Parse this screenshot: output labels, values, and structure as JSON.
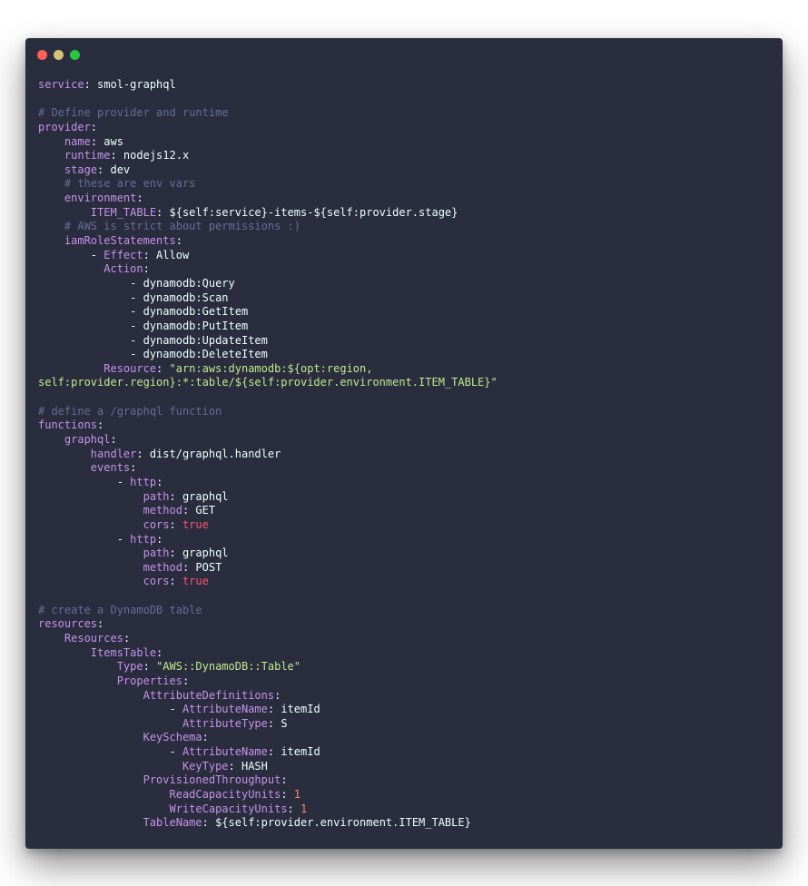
{
  "window": {
    "colors": {
      "background": "#292d3e",
      "close": "#ff5f56",
      "minimize": "#d6c27a",
      "maximize": "#27c93f",
      "key": "#c792ea",
      "comment": "#676e95",
      "string": "#c3e88d",
      "number": "#f78c6c",
      "boolean": "#ff5370",
      "text": "#eeffff"
    }
  },
  "code": {
    "language": "yaml",
    "lines": [
      [
        [
          "key",
          "service"
        ],
        [
          "plain",
          ": smol-graphql"
        ]
      ],
      [],
      [
        [
          "com",
          "# Define provider and runtime"
        ]
      ],
      [
        [
          "key",
          "provider"
        ],
        [
          "plain",
          ":"
        ]
      ],
      [
        [
          "plain",
          "    "
        ],
        [
          "key",
          "name"
        ],
        [
          "plain",
          ": aws"
        ]
      ],
      [
        [
          "plain",
          "    "
        ],
        [
          "key",
          "runtime"
        ],
        [
          "plain",
          ": nodejs12.x"
        ]
      ],
      [
        [
          "plain",
          "    "
        ],
        [
          "key",
          "stage"
        ],
        [
          "plain",
          ": dev"
        ]
      ],
      [
        [
          "plain",
          "    "
        ],
        [
          "com",
          "# these are env vars"
        ]
      ],
      [
        [
          "plain",
          "    "
        ],
        [
          "key",
          "environment"
        ],
        [
          "plain",
          ":"
        ]
      ],
      [
        [
          "plain",
          "        "
        ],
        [
          "key",
          "ITEM_TABLE"
        ],
        [
          "plain",
          ": ${self:service}-items-${self:provider.stage}"
        ]
      ],
      [
        [
          "plain",
          "    "
        ],
        [
          "com",
          "# AWS is strict about permissions :)"
        ]
      ],
      [
        [
          "plain",
          "    "
        ],
        [
          "key",
          "iamRoleStatements"
        ],
        [
          "plain",
          ":"
        ]
      ],
      [
        [
          "plain",
          "        - "
        ],
        [
          "key",
          "Effect"
        ],
        [
          "plain",
          ": Allow"
        ]
      ],
      [
        [
          "plain",
          "          "
        ],
        [
          "key",
          "Action"
        ],
        [
          "plain",
          ":"
        ]
      ],
      [
        [
          "plain",
          "              - dynamodb:Query"
        ]
      ],
      [
        [
          "plain",
          "              - dynamodb:Scan"
        ]
      ],
      [
        [
          "plain",
          "              - dynamodb:GetItem"
        ]
      ],
      [
        [
          "plain",
          "              - dynamodb:PutItem"
        ]
      ],
      [
        [
          "plain",
          "              - dynamodb:UpdateItem"
        ]
      ],
      [
        [
          "plain",
          "              - dynamodb:DeleteItem"
        ]
      ],
      [
        [
          "plain",
          "          "
        ],
        [
          "key",
          "Resource"
        ],
        [
          "plain",
          ": "
        ],
        [
          "str",
          "\"arn:aws:dynamodb:${opt:region,"
        ]
      ],
      [
        [
          "str",
          "self:provider.region}:*:table/${self:provider.environment.ITEM_TABLE}\""
        ]
      ],
      [],
      [
        [
          "com",
          "# define a /graphql function"
        ]
      ],
      [
        [
          "key",
          "functions"
        ],
        [
          "plain",
          ":"
        ]
      ],
      [
        [
          "plain",
          "    "
        ],
        [
          "key",
          "graphql"
        ],
        [
          "plain",
          ":"
        ]
      ],
      [
        [
          "plain",
          "        "
        ],
        [
          "key",
          "handler"
        ],
        [
          "plain",
          ": dist/graphql.handler"
        ]
      ],
      [
        [
          "plain",
          "        "
        ],
        [
          "key",
          "events"
        ],
        [
          "plain",
          ":"
        ]
      ],
      [
        [
          "plain",
          "            - "
        ],
        [
          "key",
          "http"
        ],
        [
          "plain",
          ":"
        ]
      ],
      [
        [
          "plain",
          "                "
        ],
        [
          "key",
          "path"
        ],
        [
          "plain",
          ": graphql"
        ]
      ],
      [
        [
          "plain",
          "                "
        ],
        [
          "key",
          "method"
        ],
        [
          "plain",
          ": GET"
        ]
      ],
      [
        [
          "plain",
          "                "
        ],
        [
          "key",
          "cors"
        ],
        [
          "plain",
          ": "
        ],
        [
          "bool",
          "true"
        ]
      ],
      [
        [
          "plain",
          "            - "
        ],
        [
          "key",
          "http"
        ],
        [
          "plain",
          ":"
        ]
      ],
      [
        [
          "plain",
          "                "
        ],
        [
          "key",
          "path"
        ],
        [
          "plain",
          ": graphql"
        ]
      ],
      [
        [
          "plain",
          "                "
        ],
        [
          "key",
          "method"
        ],
        [
          "plain",
          ": POST"
        ]
      ],
      [
        [
          "plain",
          "                "
        ],
        [
          "key",
          "cors"
        ],
        [
          "plain",
          ": "
        ],
        [
          "bool",
          "true"
        ]
      ],
      [],
      [
        [
          "com",
          "# create a DynamoDB table"
        ]
      ],
      [
        [
          "key",
          "resources"
        ],
        [
          "plain",
          ":"
        ]
      ],
      [
        [
          "plain",
          "    "
        ],
        [
          "key",
          "Resources"
        ],
        [
          "plain",
          ":"
        ]
      ],
      [
        [
          "plain",
          "        "
        ],
        [
          "key",
          "ItemsTable"
        ],
        [
          "plain",
          ":"
        ]
      ],
      [
        [
          "plain",
          "            "
        ],
        [
          "key",
          "Type"
        ],
        [
          "plain",
          ": "
        ],
        [
          "str",
          "\"AWS::DynamoDB::Table\""
        ]
      ],
      [
        [
          "plain",
          "            "
        ],
        [
          "key",
          "Properties"
        ],
        [
          "plain",
          ":"
        ]
      ],
      [
        [
          "plain",
          "                "
        ],
        [
          "key",
          "AttributeDefinitions"
        ],
        [
          "plain",
          ":"
        ]
      ],
      [
        [
          "plain",
          "                    - "
        ],
        [
          "key",
          "AttributeName"
        ],
        [
          "plain",
          ": itemId"
        ]
      ],
      [
        [
          "plain",
          "                      "
        ],
        [
          "key",
          "AttributeType"
        ],
        [
          "plain",
          ": S"
        ]
      ],
      [
        [
          "plain",
          "                "
        ],
        [
          "key",
          "KeySchema"
        ],
        [
          "plain",
          ":"
        ]
      ],
      [
        [
          "plain",
          "                    - "
        ],
        [
          "key",
          "AttributeName"
        ],
        [
          "plain",
          ": itemId"
        ]
      ],
      [
        [
          "plain",
          "                      "
        ],
        [
          "key",
          "KeyType"
        ],
        [
          "plain",
          ": HASH"
        ]
      ],
      [
        [
          "plain",
          "                "
        ],
        [
          "key",
          "ProvisionedThroughput"
        ],
        [
          "plain",
          ":"
        ]
      ],
      [
        [
          "plain",
          "                    "
        ],
        [
          "key",
          "ReadCapacityUnits"
        ],
        [
          "plain",
          ": "
        ],
        [
          "num",
          "1"
        ]
      ],
      [
        [
          "plain",
          "                    "
        ],
        [
          "key",
          "WriteCapacityUnits"
        ],
        [
          "plain",
          ": "
        ],
        [
          "num",
          "1"
        ]
      ],
      [
        [
          "plain",
          "                "
        ],
        [
          "key",
          "TableName"
        ],
        [
          "plain",
          ": ${self:provider.environment.ITEM_TABLE}"
        ]
      ]
    ]
  }
}
